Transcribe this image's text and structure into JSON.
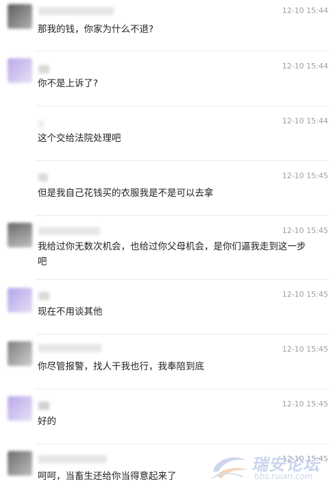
{
  "messages": [
    {
      "time": "12-10 15:44",
      "text": "那我的钱，你家为什么不退?",
      "avatar_color": "#8a8a8a"
    },
    {
      "time": "12-10 15:44",
      "text": "你不是上诉了?",
      "avatar_color": "#c9bde8"
    },
    {
      "time": "12-10 15:44",
      "text": "这个交给法院处理吧",
      "avatar_color": "#ffffff"
    },
    {
      "time": "12-10 15:45",
      "text": "但是我自己花钱买的衣服我是不是可以去拿",
      "avatar_color": "#ffffff"
    },
    {
      "time": "12-10 15:45",
      "text": "我给过你无数次机会，也给过你父母机会，是你们逼我走到这一步吧",
      "avatar_color": "#7a7a7a"
    },
    {
      "time": "12-10 15:45",
      "text": "现在不用谈其他",
      "avatar_color": "#c2b6e4"
    },
    {
      "time": "12-10 15:45",
      "text": "你尽管报警，找人干我也行，我奉陪到底",
      "avatar_color": "#9a9a9a"
    },
    {
      "time": "12-10 15:45",
      "text": "好的",
      "avatar_color": "#c9bde8"
    },
    {
      "time": "12-10 15:45",
      "text": "呵呵，当畜生还给你当得意起来了",
      "avatar_color": "#8a8a8a"
    }
  ],
  "watermark": {
    "title": "瑞安论坛",
    "url": "bbs.ruian.com"
  }
}
